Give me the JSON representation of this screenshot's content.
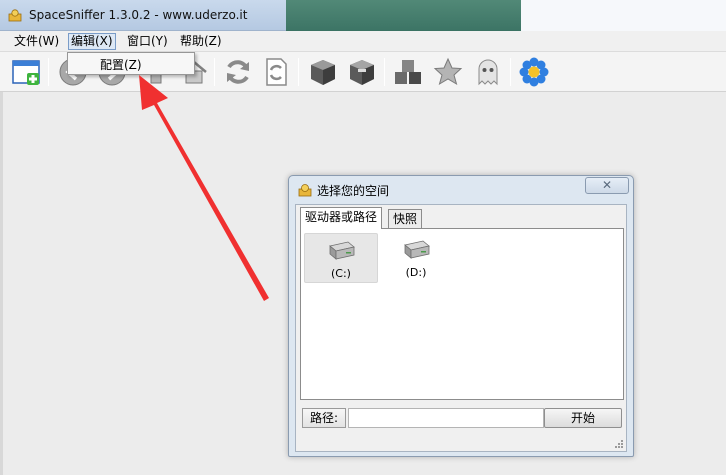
{
  "window": {
    "title": "SpaceSniffer 1.3.0.2 - www.uderzo.it"
  },
  "menubar": {
    "items": [
      {
        "label": "文件(W)"
      },
      {
        "label": "编辑(X)",
        "active": true
      },
      {
        "label": "窗口(Y)"
      },
      {
        "label": "帮助(Z)"
      }
    ]
  },
  "dropdown": {
    "items": [
      {
        "label": "配置(Z)"
      }
    ]
  },
  "toolbar": {
    "icons": [
      "new-window-icon",
      "back-icon",
      "forward-icon",
      "up-icon",
      "home-icon",
      "refresh-icon",
      "refresh-document-icon",
      "cube-icon",
      "cube-filter-icon",
      "cubes-icon",
      "star-icon",
      "ghost-icon",
      "flower-icon"
    ]
  },
  "dialog": {
    "title": "选择您的空间",
    "tabs": [
      {
        "label": "驱动器或路径",
        "active": true
      },
      {
        "label": "快照"
      }
    ],
    "drives": [
      {
        "label": "(C:)",
        "selected": true
      },
      {
        "label": "(D:)"
      }
    ],
    "path_label": "路径:",
    "path_value": "",
    "start_button": "开始"
  },
  "annotation": {
    "color": "#f03030"
  }
}
